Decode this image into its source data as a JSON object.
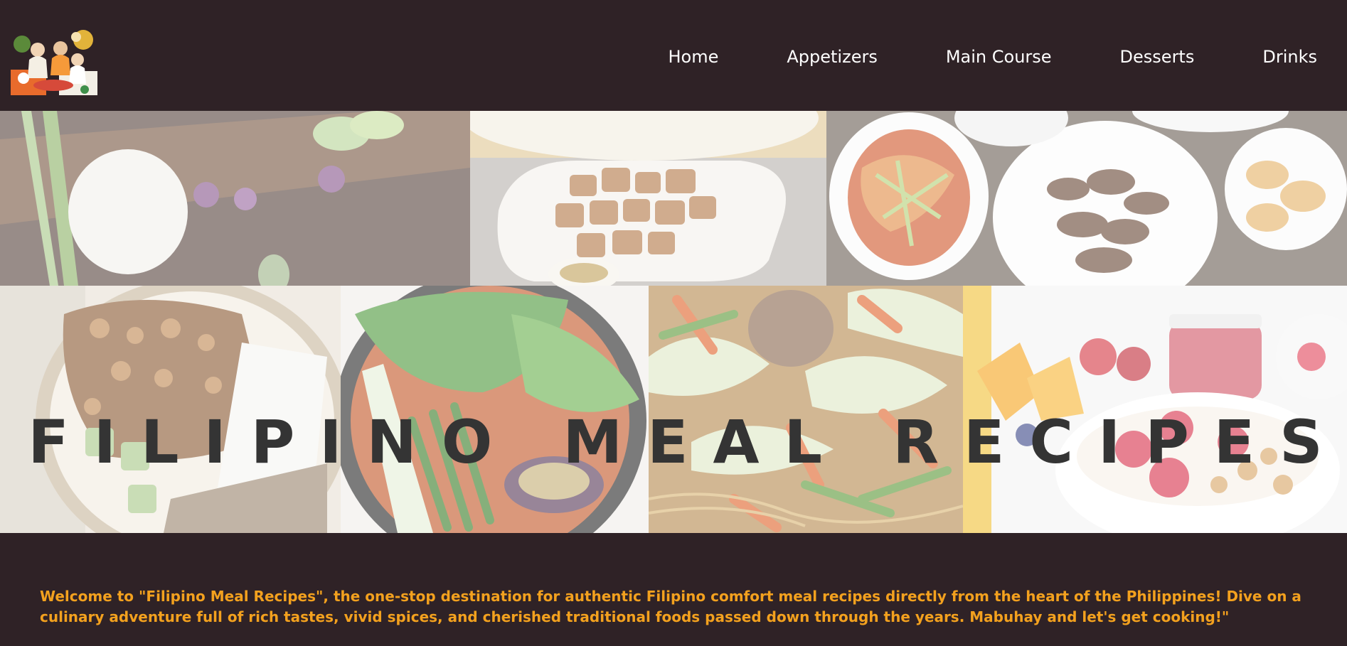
{
  "header": {
    "logo_icon": "filipino-family-meal-illustration-icon",
    "nav": [
      {
        "label": "Home"
      },
      {
        "label": "Appetizers"
      },
      {
        "label": "Main Course"
      },
      {
        "label": "Desserts"
      },
      {
        "label": "Drinks"
      }
    ]
  },
  "hero": {
    "title": "FILIPINO MEAL RECIPES",
    "photos": [
      "rice-and-vegetables-photo",
      "crispy-pork-belly-photo",
      "papaya-salad-and-grilled-meat-photo",
      "chickpea-rice-bowl-photo",
      "vegetable-stew-photo",
      "stir-fried-noodles-photo",
      "fruit-yogurt-bowl-photo"
    ]
  },
  "welcome": {
    "text": "Welcome to \"Filipino Meal Recipes\", the one-stop destination for authentic Filipino comfort meal recipes directly from the heart of the Philippines! Dive on a culinary adventure full of rich tastes, vivid spices, and cherished traditional foods passed down through the years. Mabuhay and let's get cooking!\""
  },
  "colors": {
    "background": "#2f2226",
    "nav_text": "#ffffff",
    "title_text": "#343434",
    "welcome_text": "#f3a11e"
  }
}
